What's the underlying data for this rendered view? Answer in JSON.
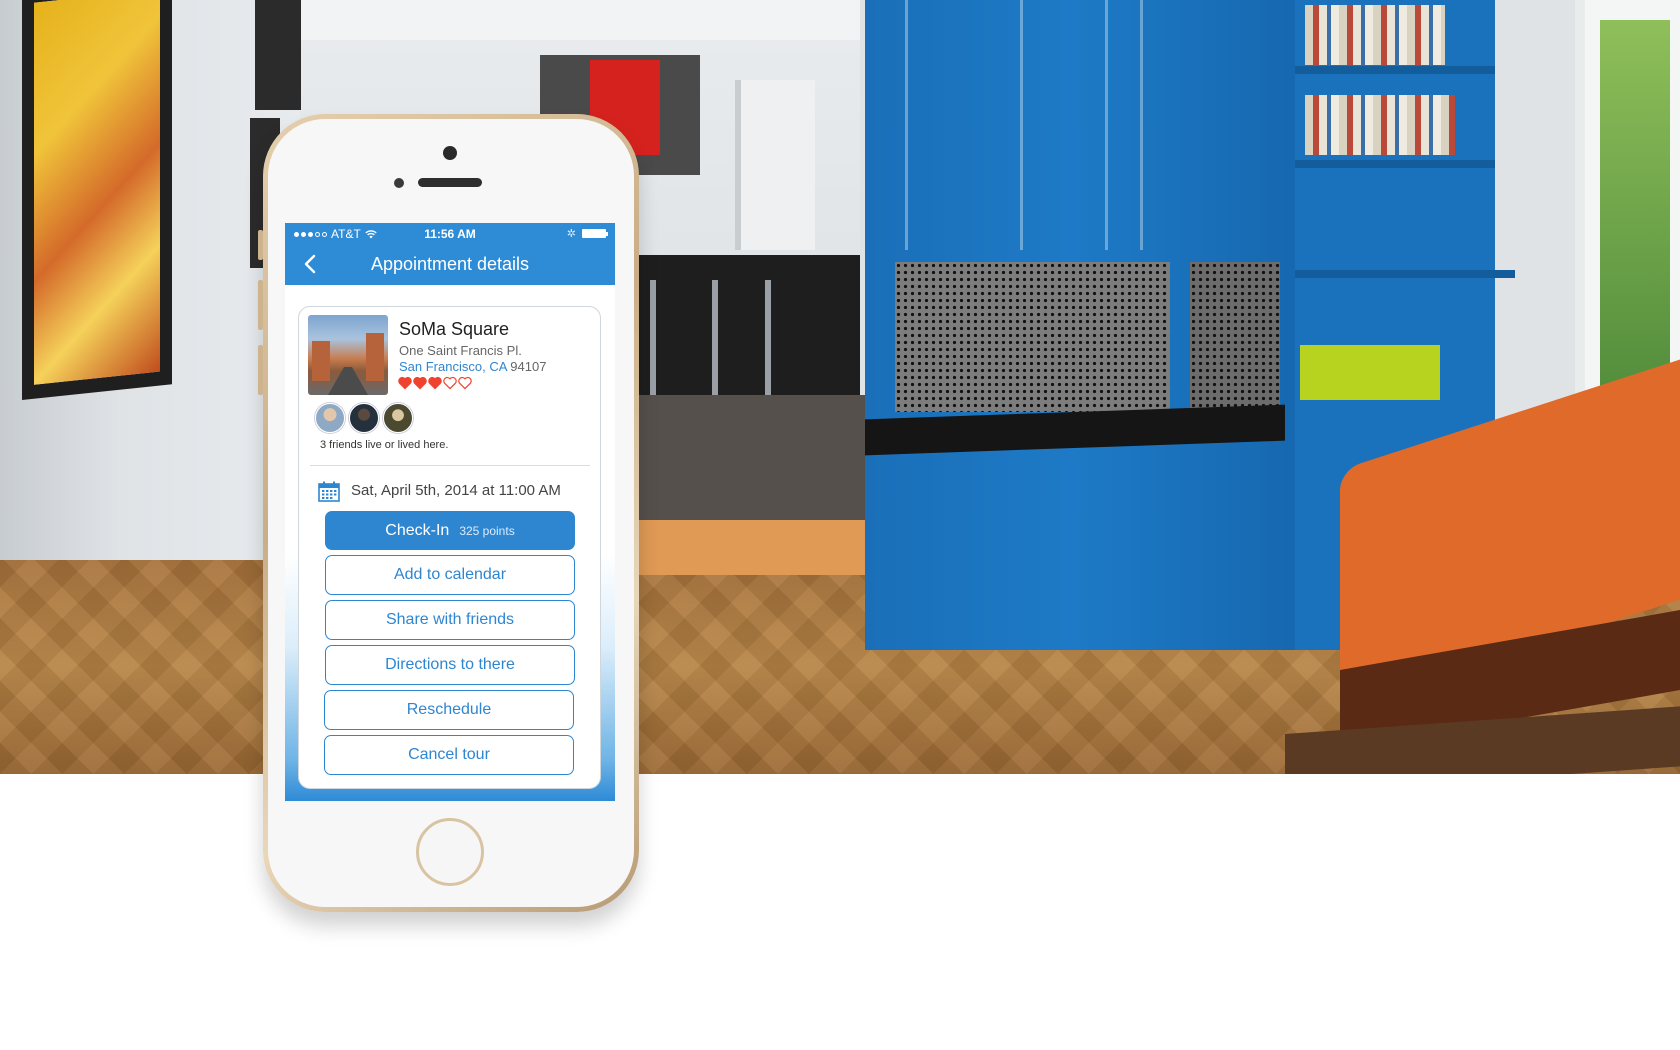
{
  "status_bar": {
    "carrier": "AT&T",
    "time": "11:56 AM"
  },
  "nav": {
    "title": "Appointment details",
    "back_icon": "chevron-left-icon"
  },
  "property": {
    "name": "SoMa Square",
    "street": "One Saint Francis Pl.",
    "city_state": "San Francisco, CA",
    "zip": "94107",
    "rating": {
      "filled": 3,
      "total": 5
    },
    "friends_text": "3 friends live or lived here."
  },
  "appointment": {
    "date_text": "Sat, April 5th, 2014 at 11:00 AM",
    "calendar_icon": "calendar-icon"
  },
  "actions": {
    "checkin_label": "Check-In",
    "checkin_points": "325 points",
    "add_calendar": "Add to calendar",
    "share": "Share with friends",
    "directions": "Directions to there",
    "reschedule": "Reschedule",
    "cancel": "Cancel tour"
  },
  "colors": {
    "accent": "#2e86d1",
    "heart": "#f0432f"
  }
}
